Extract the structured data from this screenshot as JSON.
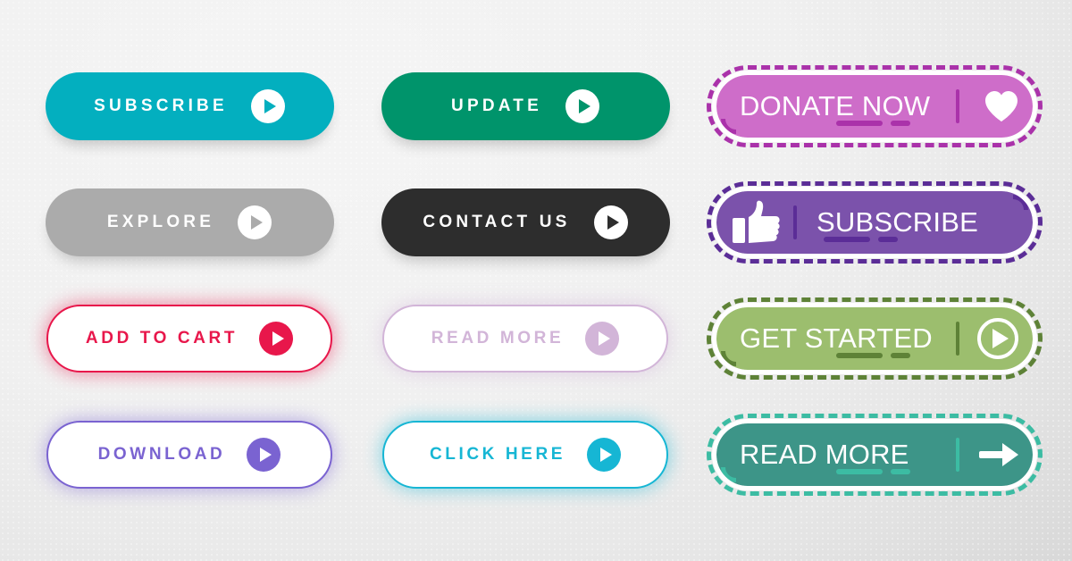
{
  "page": {
    "title": "Call To Action Button Set",
    "background_color": "#efefef",
    "background_accent": "#cdcdcd"
  },
  "buttons": [
    {
      "id": "subscribe-teal",
      "label": "SUBSCRIBE",
      "style": "solid",
      "color": "#03AFBF",
      "text_color": "#ffffff",
      "icon": "play-circle-icon",
      "icon_position": "right",
      "row": 1,
      "column": 1
    },
    {
      "id": "update-green",
      "label": "UPDATE",
      "style": "solid",
      "color": "#00946B",
      "text_color": "#ffffff",
      "icon": "play-circle-icon",
      "icon_position": "right",
      "row": 1,
      "column": 2
    },
    {
      "id": "donate-now-orchid",
      "label": "DONATE NOW",
      "style": "dashed",
      "color": "#CE6DC9",
      "outline_color": "#AA32AA",
      "text_color": "#ffffff",
      "icon": "heart-icon",
      "icon_position": "right",
      "row": 1,
      "column": 3
    },
    {
      "id": "explore-gray",
      "label": "EXPLORE",
      "style": "solid",
      "color": "#ABABAB",
      "text_color": "#ffffff",
      "icon": "play-circle-icon",
      "icon_position": "right",
      "row": 2,
      "column": 1
    },
    {
      "id": "contact-us-dark",
      "label": "CONTACT US",
      "style": "solid",
      "color": "#2D2D2D",
      "text_color": "#ffffff",
      "icon": "play-circle-icon",
      "icon_position": "right",
      "row": 2,
      "column": 2
    },
    {
      "id": "subscribe-purple",
      "label": "SUBSCRIBE",
      "style": "dashed",
      "color": "#7B52AB",
      "outline_color": "#5B2D97",
      "text_color": "#ffffff",
      "icon": "thumbs-up-icon",
      "icon_position": "left",
      "row": 2,
      "column": 3
    },
    {
      "id": "add-to-cart-crimson",
      "label": "ADD TO CART",
      "style": "white",
      "color": "#E8174B",
      "text_color": "#E8174B",
      "icon": "play-circle-filled-icon",
      "icon_position": "right",
      "row": 3,
      "column": 1
    },
    {
      "id": "read-more-lilac",
      "label": "READ MORE",
      "style": "white",
      "color": "#D2B5D8",
      "text_color": "#D2B5D8",
      "icon": "play-circle-filled-icon",
      "icon_position": "right",
      "row": 3,
      "column": 2
    },
    {
      "id": "get-started-olive",
      "label": "GET STARTED",
      "style": "dashed",
      "color": "#9CBE6E",
      "outline_color": "#5E8237",
      "text_color": "#ffffff",
      "icon": "play-circle-outline-icon",
      "icon_position": "right",
      "row": 3,
      "column": 3
    },
    {
      "id": "download-violet",
      "label": "DOWNLOAD",
      "style": "white",
      "color": "#7A63D1",
      "text_color": "#7A63D1",
      "icon": "play-circle-filled-icon",
      "icon_position": "right",
      "row": 4,
      "column": 1
    },
    {
      "id": "click-here-cyan",
      "label": "CLICK HERE",
      "style": "white",
      "color": "#16B6D4",
      "text_color": "#16B6D4",
      "icon": "play-circle-filled-icon",
      "icon_position": "right",
      "row": 4,
      "column": 2
    },
    {
      "id": "read-more-teal",
      "label": "READ MORE",
      "style": "dashed",
      "color": "#3D9588",
      "outline_color": "#3CBCA3",
      "text_color": "#ffffff",
      "icon": "arrow-right-icon",
      "icon_position": "right",
      "row": 4,
      "column": 3
    }
  ]
}
